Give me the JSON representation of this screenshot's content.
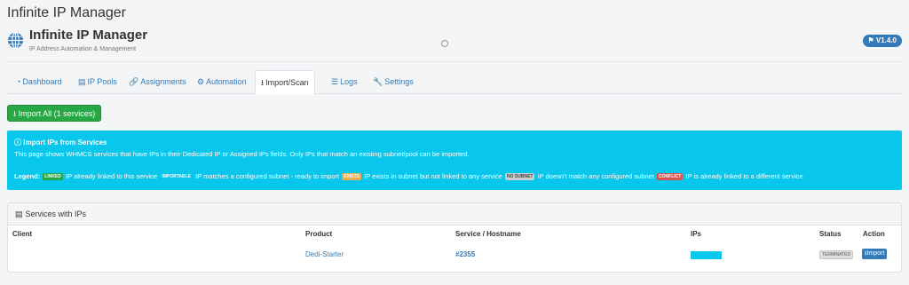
{
  "page_title": "Infinite IP Manager",
  "header": {
    "title": "Infinite IP Manager",
    "subtitle": "IP Address Automation & Management",
    "version": "V1.4.0"
  },
  "tabs": [
    {
      "label": "Dashboard",
      "icon": "dashboard-icon"
    },
    {
      "label": "IP Pools",
      "icon": "database-icon"
    },
    {
      "label": "Assignments",
      "icon": "link-icon"
    },
    {
      "label": "Automation",
      "icon": "cogs-icon"
    },
    {
      "label": "Import/Scan",
      "icon": "download-icon",
      "active": true
    },
    {
      "label": "Logs",
      "icon": "list-icon"
    },
    {
      "label": "Settings",
      "icon": "wrench-icon"
    }
  ],
  "import_all_label": "Import All (1 services)",
  "info": {
    "title": "Import IPs from Services",
    "description": "This page shows WHMCS services that have IPs in their Dedicated IP or Assigned IPs fields. Only IPs that match an existing subnet/pool can be imported.",
    "legend_label": "Legend:",
    "legend": [
      {
        "tag": "LINKED",
        "text": "IP already linked to this service"
      },
      {
        "tag": "IMPORTABLE",
        "text": "IP matches a configured subnet - ready to import"
      },
      {
        "tag": "EXISTS",
        "text": "IP exists in subnet but not linked to any service"
      },
      {
        "tag": "NO SUBNET",
        "text": "IP doesn't match any configured subnet"
      },
      {
        "tag": "CONFLICT",
        "text": "IP is already linked to a different service"
      }
    ]
  },
  "services_panel": {
    "title": "Services with IPs",
    "columns": [
      "Client",
      "Product",
      "Service / Hostname",
      "IPs",
      "Status",
      "Action"
    ],
    "rows": [
      {
        "client": "",
        "product": "Dedi-Starter",
        "service": "#2355",
        "status": "TERMINATED",
        "action": "Import"
      }
    ]
  },
  "colors": {
    "accent": "#337ab7",
    "info": "#08c6ec",
    "success": "#28a745"
  }
}
